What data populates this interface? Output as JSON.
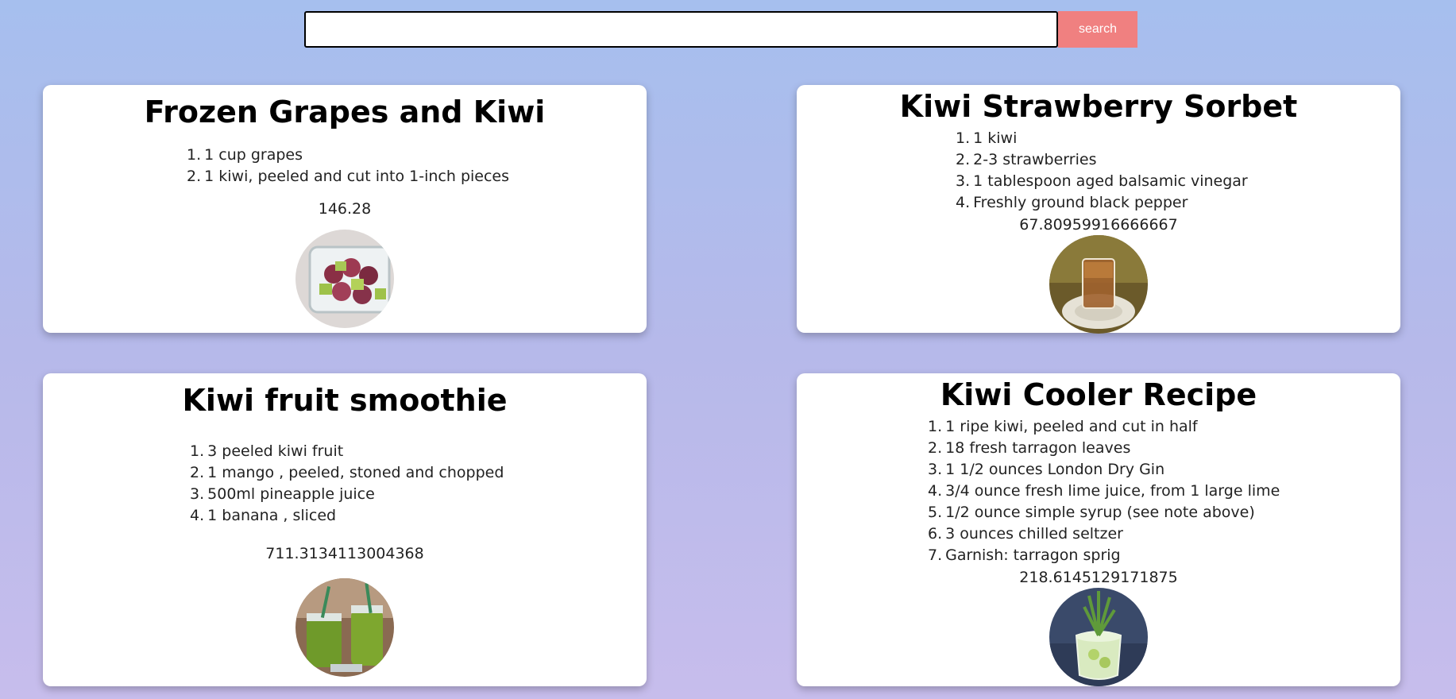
{
  "search": {
    "value": "",
    "placeholder": "",
    "button_label": "search"
  },
  "recipes": [
    {
      "title": "Frozen Grapes and Kiwi",
      "ingredients": [
        "1 cup grapes",
        "1 kiwi, peeled and cut into 1-inch pieces"
      ],
      "value": "146.28",
      "image": "frozen-grapes-kiwi-photo"
    },
    {
      "title": "Kiwi Strawberry Sorbet",
      "ingredients": [
        "1 kiwi",
        "2-3 strawberries",
        "1 tablespoon aged balsamic vinegar",
        "Freshly ground black pepper"
      ],
      "value": "67.80959916666667",
      "image": "sorbet-glass-photo"
    },
    {
      "title": "Kiwi fruit smoothie",
      "ingredients": [
        "3 peeled kiwi fruit",
        "1 mango , peeled, stoned and chopped",
        "500ml pineapple juice",
        "1 banana , sliced"
      ],
      "value": "711.3134113004368",
      "image": "kiwi-smoothie-jars-photo"
    },
    {
      "title": "Kiwi Cooler Recipe",
      "ingredients": [
        "1 ripe kiwi, peeled and cut in half",
        "18 fresh tarragon leaves",
        "1 1/2 ounces London Dry Gin",
        "3/4 ounce fresh lime juice, from 1 large lime",
        "1/2 ounce simple syrup (see note above)",
        "3 ounces chilled seltzer",
        "Garnish: tarragon sprig"
      ],
      "value": "218.6145129171875",
      "image": "kiwi-cooler-glass-photo"
    }
  ],
  "list_numbers": [
    "1.",
    "2.",
    "3.",
    "4.",
    "5.",
    "6.",
    "7."
  ]
}
